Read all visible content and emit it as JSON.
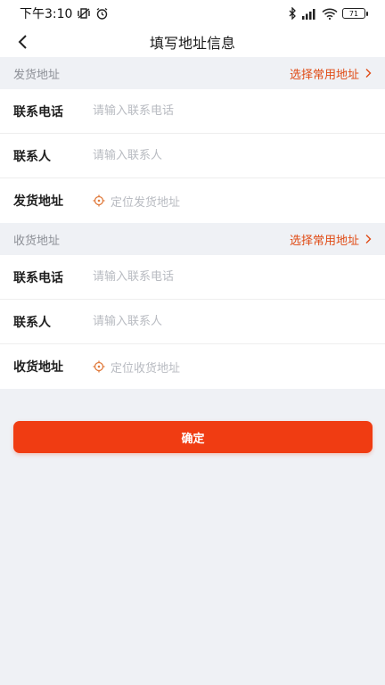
{
  "status_bar": {
    "time": "下午3:10",
    "battery": "71"
  },
  "header": {
    "title": "填写地址信息"
  },
  "sender": {
    "section_label": "发货地址",
    "common_link": "选择常用地址",
    "phone_label": "联系电话",
    "phone_placeholder": "请输入联系电话",
    "contact_label": "联系人",
    "contact_placeholder": "请输入联系人",
    "address_label": "发货地址",
    "address_hint": "定位发货地址"
  },
  "receiver": {
    "section_label": "收货地址",
    "common_link": "选择常用地址",
    "phone_label": "联系电话",
    "phone_placeholder": "请输入联系电话",
    "contact_label": "联系人",
    "contact_placeholder": "请输入联系人",
    "address_label": "收货地址",
    "address_hint": "定位收货地址"
  },
  "actions": {
    "confirm_label": "确定"
  },
  "colors": {
    "accent": "#e04a14",
    "button": "#f03c12",
    "background": "#eff1f5"
  }
}
